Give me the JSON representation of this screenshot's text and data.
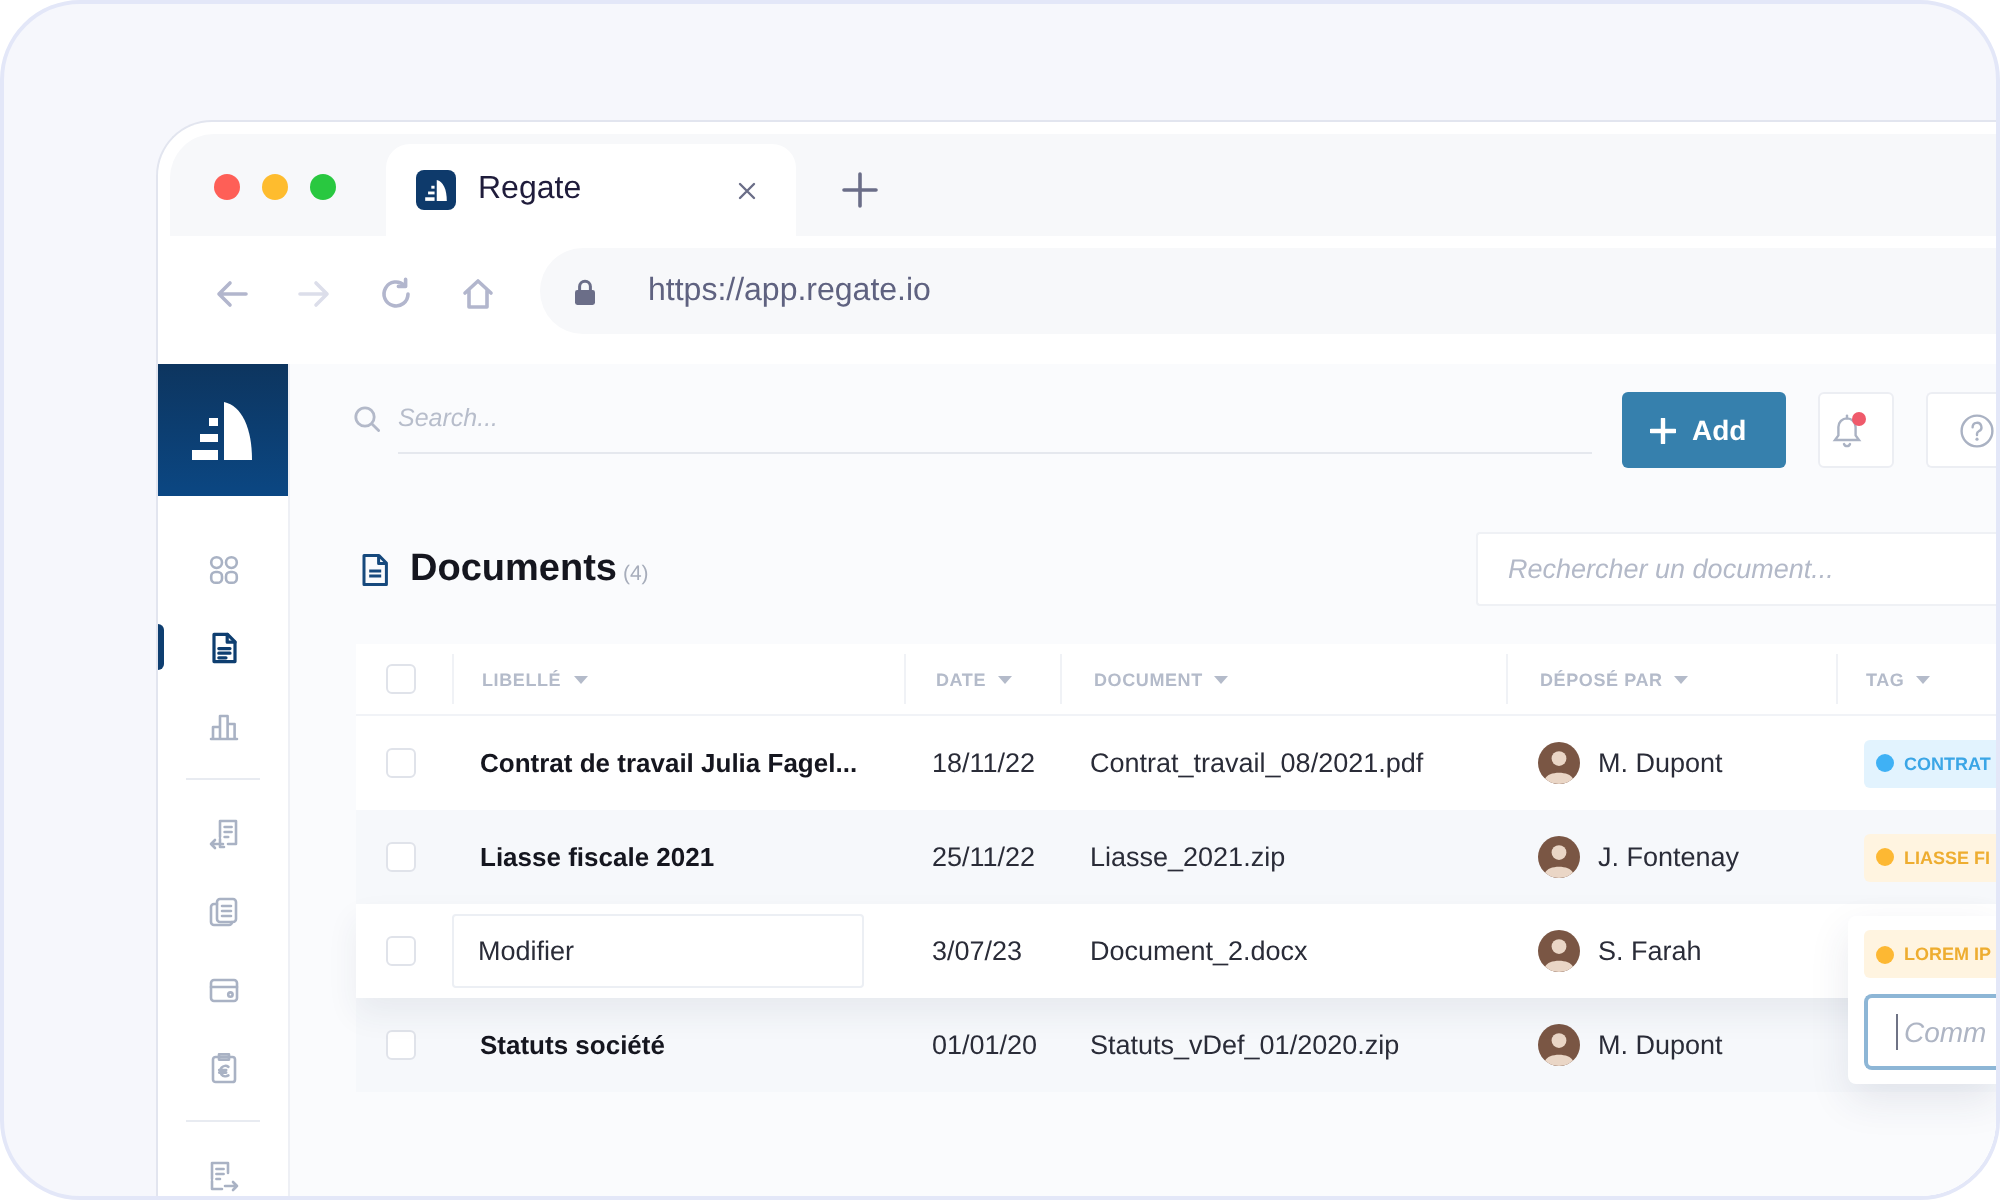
{
  "window_buttons": [
    {
      "color": "#fe5f57"
    },
    {
      "color": "#febc2e"
    },
    {
      "color": "#29c840"
    }
  ],
  "tabs": [
    {
      "title": "Regate",
      "selected": true
    }
  ],
  "nav_buttons": [
    {
      "disabled": false
    },
    {
      "disabled": true
    },
    {
      "disabled": false
    },
    {
      "disabled": false
    }
  ],
  "address_bar": {
    "url": "https://app.regate.io"
  },
  "sidebar": {
    "groups": [
      [
        {
          "selected": false
        },
        {
          "selected": true
        },
        {
          "selected": false
        }
      ],
      [
        {
          "selected": false
        },
        {
          "selected": false
        },
        {
          "selected": false
        },
        {
          "selected": false
        }
      ],
      [
        {
          "selected": false
        }
      ]
    ]
  },
  "top_bar": {
    "search": {
      "placeholder": "Search..."
    },
    "add_button": {
      "label": "Add"
    },
    "notifications": {
      "unread": true
    }
  },
  "documents": {
    "title": "Documents",
    "count": "(4)",
    "search": {
      "placeholder": "Rechercher un document..."
    },
    "table": {
      "header_checked": false,
      "columns": [
        "LIBELLÉ",
        "DATE",
        "DOCUMENT",
        "DÉPOSÉ PAR",
        "TAG"
      ],
      "rows": [
        {
          "checked": false,
          "label": "Contrat de travail Julia Fagel...",
          "editing": false,
          "date": "18/11/22",
          "document": "Contrat_travail_08/2021.pdf",
          "uploaded_by": "M. Dupont",
          "tag": {
            "label": "CONTRAT",
            "color": "#3fb1f5"
          }
        },
        {
          "checked": false,
          "label": "Liasse fiscale 2021",
          "editing": false,
          "date": "25/11/22",
          "document": "Liasse_2021.zip",
          "uploaded_by": "J. Fontenay",
          "tag": {
            "label": "LIASSE FI",
            "color": "#fdb833"
          }
        },
        {
          "checked": false,
          "label": "Modifier",
          "editing": true,
          "date": "3/07/23",
          "document": "Document_2.docx",
          "uploaded_by": "S. Farah",
          "tag_popup": {
            "tag": {
              "label": "LOREM IP",
              "color": "#fdb833"
            },
            "comment": {
              "placeholder": "Comm",
              "focused": true
            }
          }
        },
        {
          "checked": false,
          "label": "Statuts société",
          "editing": false,
          "date": "01/01/20",
          "document": "Statuts_vDef_01/2020.zip",
          "uploaded_by": "M. Dupont"
        }
      ]
    }
  }
}
